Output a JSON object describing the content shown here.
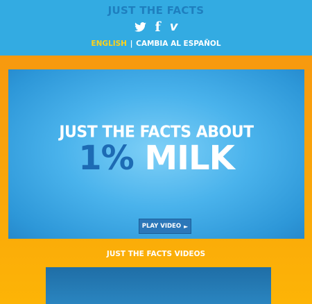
{
  "header": {
    "title": "JUST THE FACTS",
    "social_icons": [
      "twitter-icon",
      "facebook-icon",
      "vimeo-icon"
    ],
    "facebook_glyph": "f",
    "vimeo_glyph": "v",
    "lang_active": "ENGLISH",
    "lang_separator": "|",
    "lang_other": "CAMBIA AL ESPAÑOL"
  },
  "hero": {
    "line1": "JUST THE FACTS ABOUT",
    "line2_percent": "1%",
    "line2_word": "MILK",
    "play_label": "PLAY VIDEO",
    "play_glyph": "►"
  },
  "videos": {
    "title": "JUST THE FACTS VIDEOS"
  },
  "colors": {
    "header_bg": "#33abe2",
    "title": "#1e7fbf",
    "accent_yellow": "#ffd21a",
    "orange": "#f7a20c",
    "button_blue": "#2b77b9"
  }
}
